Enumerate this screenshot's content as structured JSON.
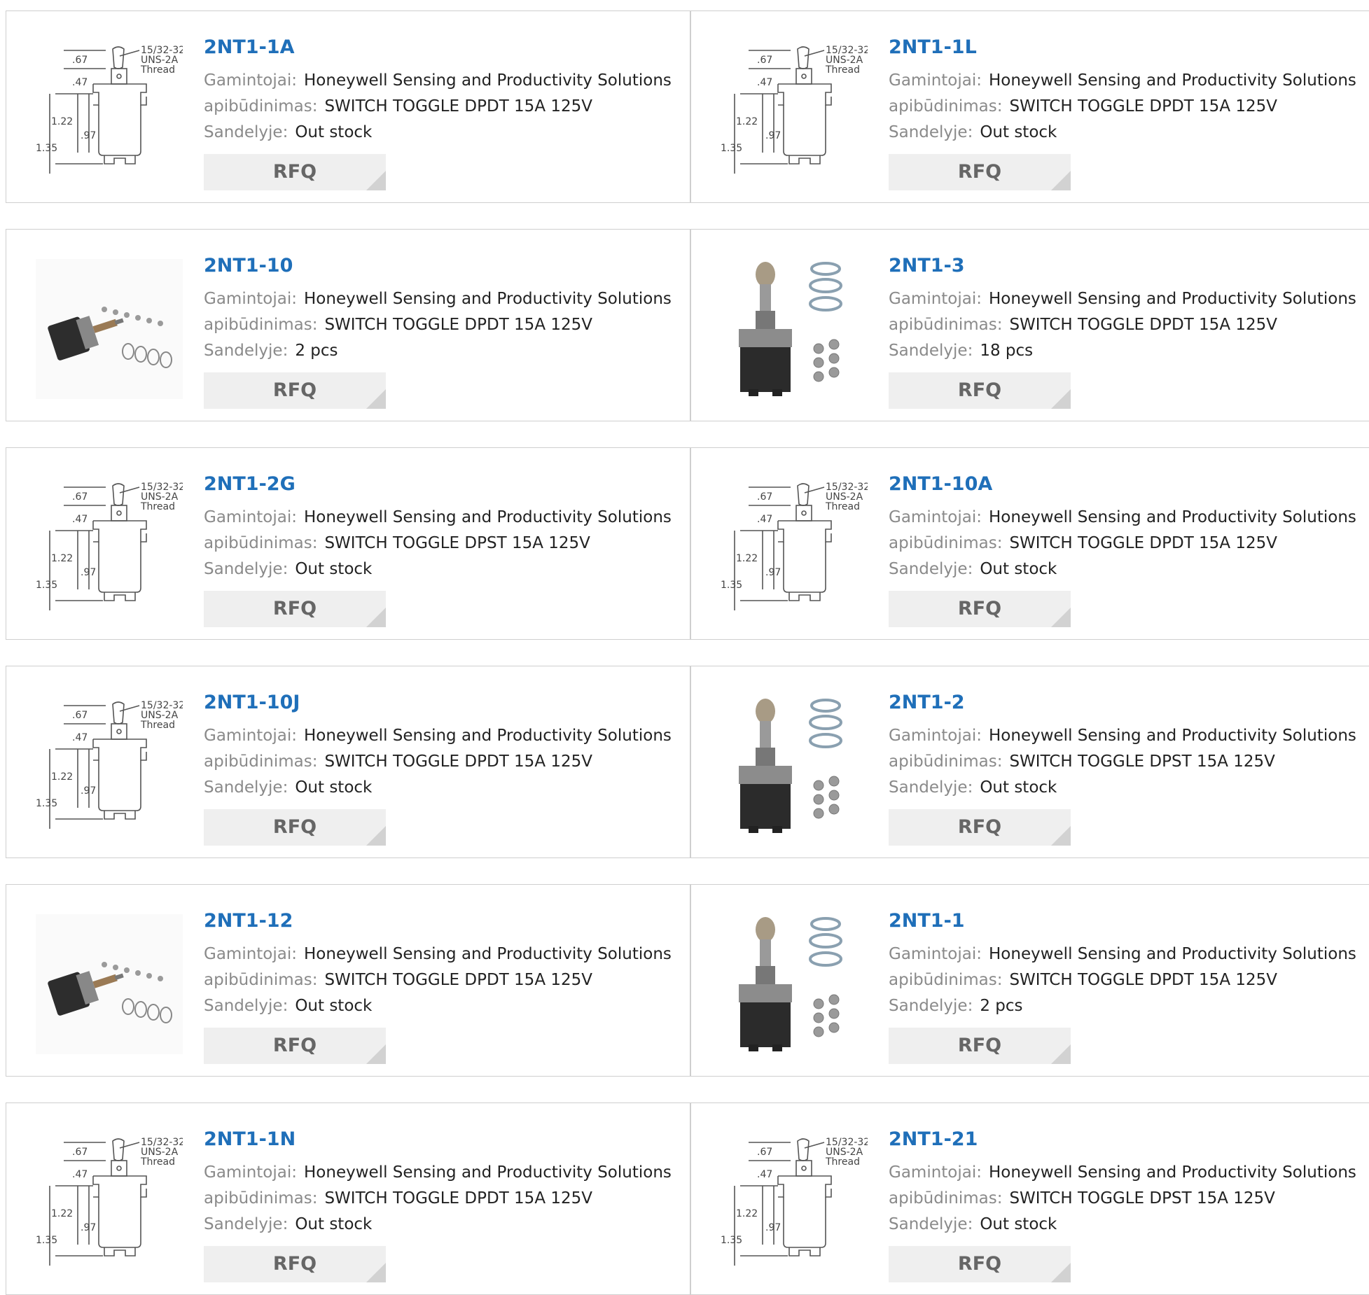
{
  "labels": {
    "manufacturer": "Gamintojai:",
    "description": "apibūdinimas:",
    "stock": "Sandelyje:",
    "rfq": "RFQ"
  },
  "products": [
    {
      "part": "2NT1-1A",
      "manufacturer": "Honeywell Sensing and Productivity Solutions",
      "description": "SWITCH TOGGLE DPDT 15A 125V",
      "stock": "Out stock",
      "image": "diagram-icon"
    },
    {
      "part": "2NT1-1L",
      "manufacturer": "Honeywell Sensing and Productivity Solutions",
      "description": "SWITCH TOGGLE DPDT 15A 125V",
      "stock": "Out stock",
      "image": "diagram-icon"
    },
    {
      "part": "2NT1-10",
      "manufacturer": "Honeywell Sensing and Productivity Solutions",
      "description": "SWITCH TOGGLE DPDT 15A 125V",
      "stock": "2 pcs",
      "image": "side-view-icon"
    },
    {
      "part": "2NT1-3",
      "manufacturer": "Honeywell Sensing and Productivity Solutions",
      "description": "SWITCH TOGGLE DPDT 15A 125V",
      "stock": "18 pcs",
      "image": "toggle-photo-icon"
    },
    {
      "part": "2NT1-2G",
      "manufacturer": "Honeywell Sensing and Productivity Solutions",
      "description": "SWITCH TOGGLE DPST 15A 125V",
      "stock": "Out stock",
      "image": "diagram-icon"
    },
    {
      "part": "2NT1-10A",
      "manufacturer": "Honeywell Sensing and Productivity Solutions",
      "description": "SWITCH TOGGLE DPDT 15A 125V",
      "stock": "Out stock",
      "image": "diagram-icon"
    },
    {
      "part": "2NT1-10J",
      "manufacturer": "Honeywell Sensing and Productivity Solutions",
      "description": "SWITCH TOGGLE DPDT 15A 125V",
      "stock": "Out stock",
      "image": "diagram-icon"
    },
    {
      "part": "2NT1-2",
      "manufacturer": "Honeywell Sensing and Productivity Solutions",
      "description": "SWITCH TOGGLE DPST 15A 125V",
      "stock": "Out stock",
      "image": "toggle-photo-icon"
    },
    {
      "part": "2NT1-12",
      "manufacturer": "Honeywell Sensing and Productivity Solutions",
      "description": "SWITCH TOGGLE DPDT 15A 125V",
      "stock": "Out stock",
      "image": "side-view-icon"
    },
    {
      "part": "2NT1-1",
      "manufacturer": "Honeywell Sensing and Productivity Solutions",
      "description": "SWITCH TOGGLE DPDT 15A 125V",
      "stock": "2 pcs",
      "image": "toggle-photo-icon"
    },
    {
      "part": "2NT1-1N",
      "manufacturer": "Honeywell Sensing and Productivity Solutions",
      "description": "SWITCH TOGGLE DPDT 15A 125V",
      "stock": "Out stock",
      "image": "diagram-icon"
    },
    {
      "part": "2NT1-21",
      "manufacturer": "Honeywell Sensing and Productivity Solutions",
      "description": "SWITCH TOGGLE DPST 15A 125V",
      "stock": "Out stock",
      "image": "diagram-icon"
    }
  ],
  "diagram_dims": {
    "thread": [
      "15/32-32",
      "UNS-2A",
      "Thread"
    ],
    "d1": ".67",
    "d2": ".47",
    "d3": "1.22",
    "d4": ".97",
    "d5": "1.35"
  }
}
